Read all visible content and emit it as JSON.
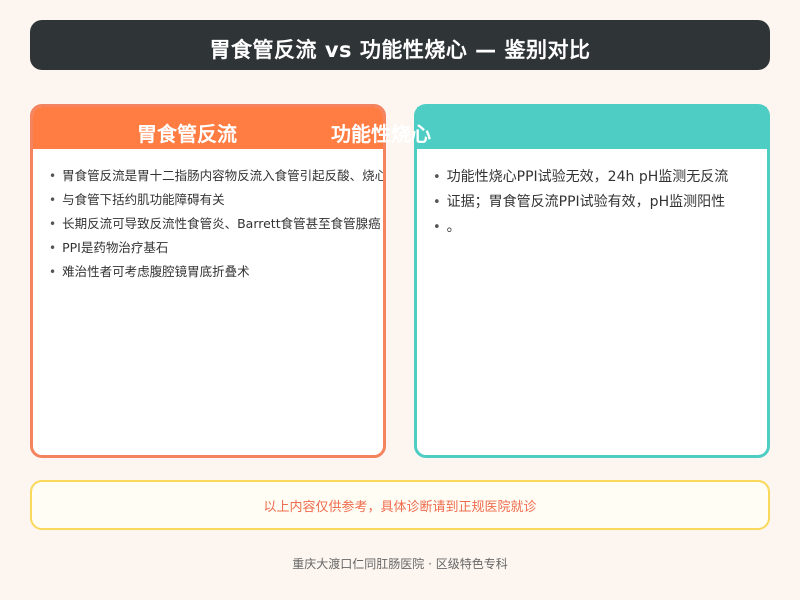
{
  "title": "胃食管反流 vs 功能性烧心 — 鉴别对比",
  "left_card": {
    "title": "胃食管反流",
    "items": [
      "胃食管反流是胃十二指肠内容物反流入食管引起反酸、烧心",
      "与食管下括约肌功能障碍有关",
      "长期反流可导致反流性食管炎、Barrett食管甚至食管腺癌",
      "PPI是药物治疗基石",
      "难治性者可考虑腹腔镜胃底折叠术"
    ]
  },
  "right_card": {
    "title": "功能性烧心",
    "items": [
      "功能性烧心PPI试验无效，24h pH监测无反流",
      "证据；胃食管反流PPI试验有效，pH监测阳性",
      "。"
    ]
  },
  "notice": "以上内容仅供参考，具体诊断请到正规医院就诊",
  "footer": "重庆大渡口仁同肛肠医院 · 区级特色专科",
  "colors": {
    "title_bg": "#2f3436",
    "left_accent": "#ff7c43",
    "right_accent": "#4ecdc4",
    "notice_border": "#f9d85a",
    "notice_text": "#ef6c4e",
    "page_bg": "#fdf6f0"
  }
}
